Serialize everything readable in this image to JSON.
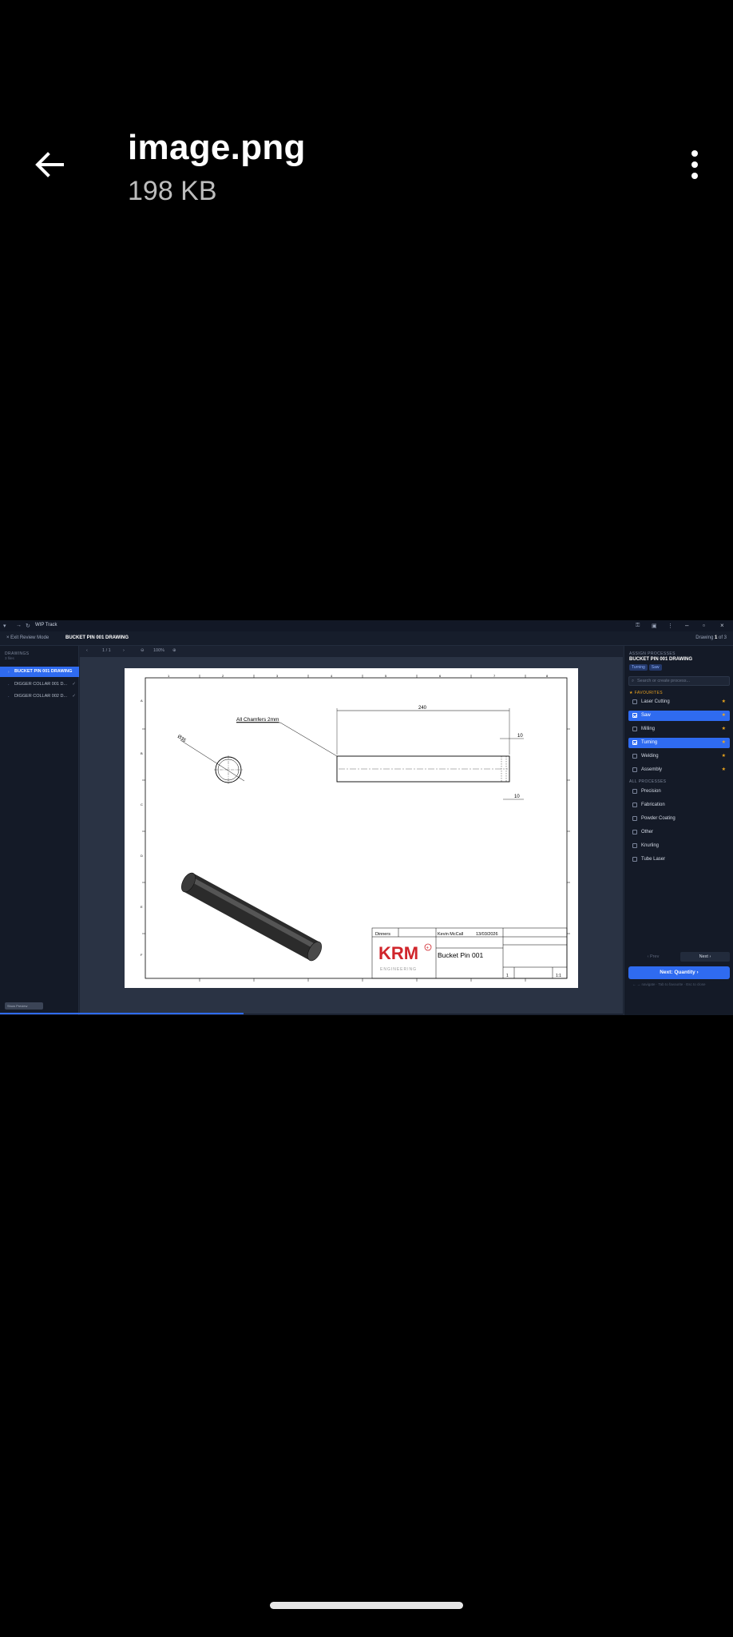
{
  "viewer": {
    "file_name": "image.png",
    "file_size": "198 KB"
  },
  "app": {
    "window_title": "WIP Track",
    "exit_label": "Exit Review Mode",
    "document_title": "BUCKET PIN 001 DRAWING",
    "counter_prefix": "Drawing",
    "counter_current": "1",
    "counter_suffix": "of 3",
    "left_panel": {
      "heading": "DRAWINGS",
      "subheading": "3 files",
      "items": [
        {
          "label": "BUCKET PIN 001 DRAWING",
          "active": true
        },
        {
          "label": "DIGGER COLLAR 001 D...",
          "active": false
        },
        {
          "label": "DIGGER COLLAR 002 D...",
          "active": false
        }
      ]
    },
    "viewer_bar": {
      "page": "1 / 1",
      "zoom": "100%"
    },
    "drawing": {
      "annotation": "All Chamfers 2mm",
      "dim_length": "240",
      "dim_diameter": "Ø35",
      "dim_chamfer_top": "10",
      "dim_chamfer_bottom": "10",
      "title_block": {
        "drawn_by": "Kevin McCall",
        "date": "13/03/2026",
        "title": "Bucket Pin 001",
        "scale": "1:1",
        "sheet": "1",
        "units": "Dinners",
        "logo_text": "KRM",
        "logo_sub": "ENGINEERING"
      }
    },
    "right_panel": {
      "heading": "ASSIGN PROCESSES",
      "document_title": "BUCKET PIN 001 DRAWING",
      "tags": [
        "Turning",
        "Saw"
      ],
      "search_placeholder": "Search or create process...",
      "favourites_label": "FAVOURITES",
      "favourites": [
        {
          "label": "Laser Cutting",
          "checked": false
        },
        {
          "label": "Saw",
          "checked": true
        },
        {
          "label": "Milling",
          "checked": false
        },
        {
          "label": "Turning",
          "checked": true
        },
        {
          "label": "Welding",
          "checked": false
        },
        {
          "label": "Assembly",
          "checked": false
        }
      ],
      "all_label": "ALL PROCESSES",
      "all": [
        {
          "label": "Precision"
        },
        {
          "label": "Fabrication"
        },
        {
          "label": "Powder Coating"
        },
        {
          "label": "Other"
        },
        {
          "label": "Knurling"
        },
        {
          "label": "Tube Laser"
        }
      ],
      "prev_label": "‹ Prev",
      "next_label": "Next ›",
      "next_quantity_label": "Next: Quantity",
      "hint": "← → navigate · Tab to favourite · Esc to close"
    },
    "status_button": "Show Preview",
    "colors": {
      "accent": "#2f6bf0",
      "favourite_star": "#f0a81c",
      "logo_red": "#d0252b"
    }
  }
}
